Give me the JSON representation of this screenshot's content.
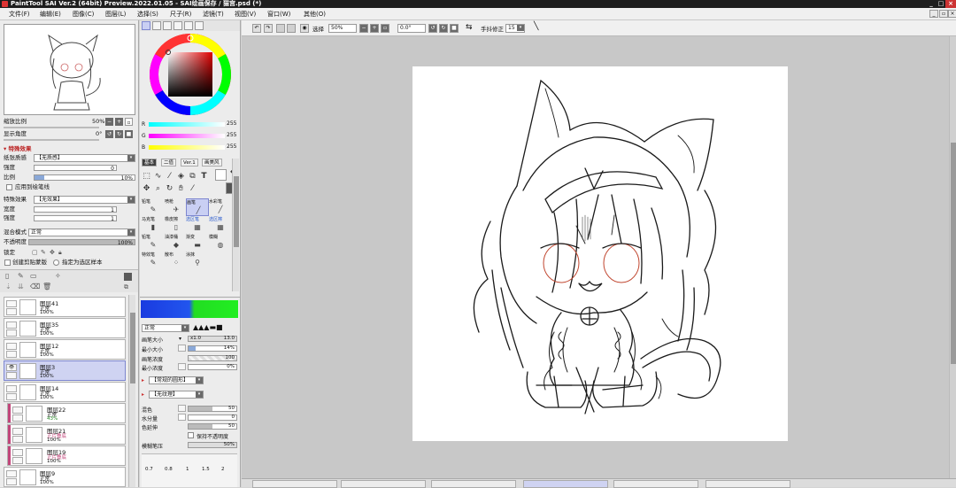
{
  "window": {
    "title": "PaintTool SAI Ver.2 (64bit) Preview.2022.01.05 - SAI绘画保存 / 猫宫.psd (*)",
    "controls": [
      "_",
      "□",
      "×"
    ]
  },
  "menu": [
    "文件(F)",
    "编辑(E)",
    "图像(C)",
    "图层(L)",
    "选择(S)",
    "尺子(R)",
    "滤镜(T)",
    "视图(V)",
    "窗口(W)",
    "其他(O)"
  ],
  "navigator": {
    "zoom_label": "缩放比例",
    "zoom_value": "50%",
    "angle_label": "显示角度",
    "angle_value": "0°"
  },
  "effects": {
    "header": "特殊效果",
    "paper_label": "纸张质感",
    "paper_value": "【无质感】",
    "strength_label": "强度",
    "strength_value": "0",
    "scale_label": "比例",
    "scale_value": "10%",
    "apply_brush": "应用到绘笔线",
    "effect_label": "特殊效果",
    "effect_value": "【无效果】",
    "width_label": "宽度",
    "width_value": "1",
    "strength2_label": "强度",
    "strength2_value": "1"
  },
  "layer_props": {
    "blend_label": "混合模式",
    "blend_value": "正常",
    "opacity_label": "不透明度",
    "opacity_value": "100%",
    "lock_label": "锁定",
    "clip_label": "创建剪贴蒙版",
    "sample_label": "指定为选区样本"
  },
  "layers": [
    {
      "name": "图层41",
      "mode": "正常",
      "opacity": "100%",
      "selected": false,
      "clip": false
    },
    {
      "name": "图层35",
      "mode": "正常",
      "opacity": "100%",
      "selected": false,
      "clip": false
    },
    {
      "name": "图层12",
      "mode": "正常",
      "opacity": "100%",
      "selected": false,
      "clip": false
    },
    {
      "name": "图层3",
      "mode": "正常",
      "opacity": "100%",
      "selected": true,
      "clip": false
    },
    {
      "name": "图层14",
      "mode": "正常",
      "opacity": "100%",
      "selected": false,
      "clip": false
    },
    {
      "name": "图层22",
      "mode": "正常",
      "opacity": "43%",
      "selected": false,
      "clip": true
    },
    {
      "name": "图层21",
      "mode": "正片叠底",
      "opacity": "100%",
      "selected": false,
      "clip": true
    },
    {
      "name": "图层19",
      "mode": "正片叠底",
      "opacity": "100%",
      "selected": false,
      "clip": true
    },
    {
      "name": "图层9",
      "mode": "正常",
      "opacity": "100%",
      "selected": false,
      "clip": false
    }
  ],
  "color": {
    "r_label": "R",
    "r_value": "255",
    "g_label": "G",
    "g_value": "255",
    "b_label": "B",
    "b_value": "255",
    "r_color": "#ff4040",
    "g_color": "#ee22ee",
    "b_color": "#f0e020"
  },
  "tool_tabs": [
    "基本",
    "二值",
    "Ver.1",
    "画美风"
  ],
  "brushes": [
    {
      "name": "铅笔",
      "icon": "✎",
      "on": false
    },
    {
      "name": "喷枪",
      "icon": "✈",
      "on": false
    },
    {
      "name": "画笔",
      "icon": "╱",
      "on": true
    },
    {
      "name": "水彩笔",
      "icon": "╱",
      "on": false
    },
    {
      "name": "马克笔",
      "icon": "▮",
      "on": false
    },
    {
      "name": "橡皮擦",
      "icon": "▯",
      "on": false
    },
    {
      "name": "选区笔",
      "icon": "▦",
      "on": false
    },
    {
      "name": "选区擦",
      "icon": "▦",
      "on": false
    },
    {
      "name": "铅笔",
      "icon": "✎",
      "on": false
    },
    {
      "name": "油漆桶",
      "icon": "◆",
      "on": false
    },
    {
      "name": "渐变",
      "icon": "▬",
      "on": false
    },
    {
      "name": "模糊",
      "icon": "◍",
      "on": false
    },
    {
      "name": "特效笔",
      "icon": "✎",
      "on": false
    },
    {
      "name": "散布",
      "icon": "⁘",
      "on": false
    },
    {
      "name": "涂抹",
      "icon": "⚲",
      "on": false
    }
  ],
  "brush_settings": {
    "blend": "正常",
    "size_label": "画笔大小",
    "size_mult": "x1.0",
    "size_value": "13.0",
    "minsize_label": "最小大小",
    "minsize_value": "14%",
    "density_label": "画笔浓度",
    "density_value": "100",
    "mindensity_label": "最小浓度",
    "mindensity_value": "0%",
    "shape": "【常规的圆形】",
    "texture": "【无纹理】",
    "mix_label": "混色",
    "mix_value": "50",
    "water_label": "水分量",
    "water_value": "0",
    "stretch_label": "色延伸",
    "stretch_value": "50",
    "keep_opacity": "保持不透明度",
    "blur_label": "模糊笔压",
    "blur_value": "50%",
    "size_presets": [
      "0.7",
      "0.8",
      "1",
      "1.5",
      "2"
    ]
  },
  "canvas_toolbar": {
    "select_label": "选择",
    "zoom": "50%",
    "angle": "0.0°",
    "stabilizer_label": "手抖修正",
    "stabilizer_value": "15"
  },
  "doc_tabs": [
    "",
    "",
    "",
    "",
    "",
    ""
  ]
}
